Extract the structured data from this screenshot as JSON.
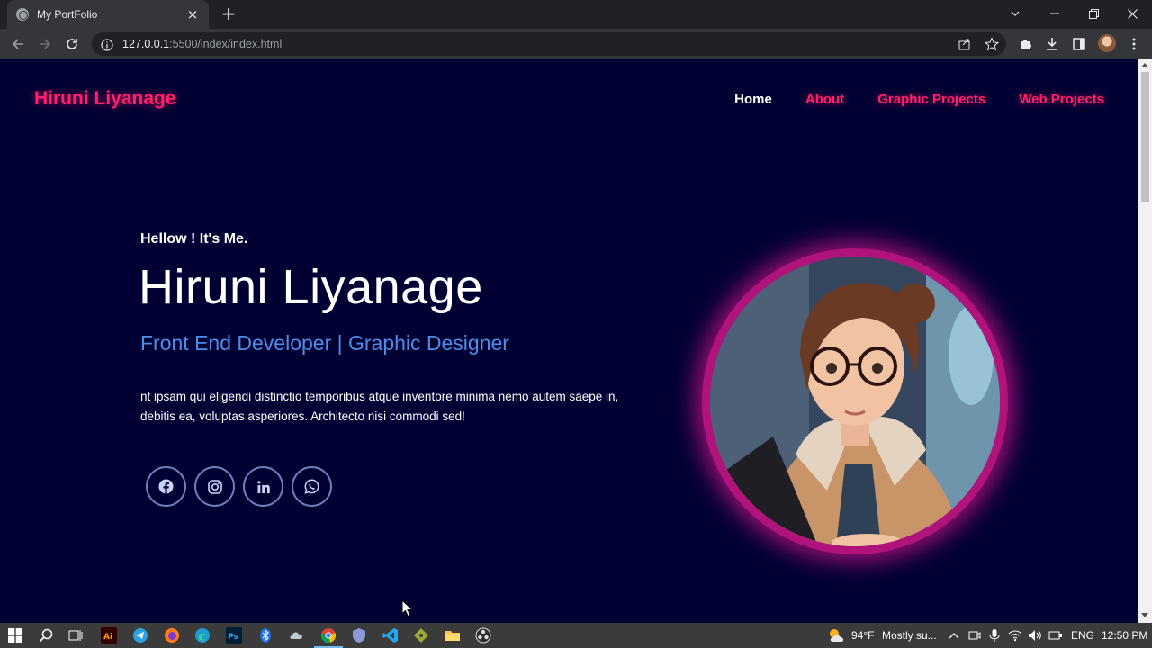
{
  "browser": {
    "tab_title": "My PortFolio",
    "tab_close": "×",
    "new_tab": "+",
    "url_host": "127.0.0.1",
    "url_path": ":5500/index/index.html"
  },
  "site": {
    "logo": "Hiruni Liyanage",
    "nav": {
      "home": "Home",
      "about": "About",
      "graphic_projects": "Graphic Projects",
      "web_projects": "Web Projects"
    },
    "hero": {
      "greeting": "Hellow ! It's Me.",
      "name": "Hiruni Liyanage",
      "role": "Front End Developer | Graphic Designer",
      "description": "nt ipsam qui eligendi distinctio temporibus atque inventore minima nemo autem saepe in, debitis ea, voluptas asperiores. Architecto nisi commodi sed!"
    },
    "socials": [
      "facebook-icon",
      "instagram-icon",
      "linkedin-icon",
      "whatsapp-icon"
    ],
    "colors": {
      "background": "#000033",
      "accent_pink": "#ff1f6a",
      "role_blue": "#4d8de8",
      "ring_magenta": "#b0147a"
    }
  },
  "taskbar": {
    "weather_temp": "94°F",
    "weather_text": "Mostly su...",
    "language": "ENG",
    "time": "12:50 PM"
  }
}
